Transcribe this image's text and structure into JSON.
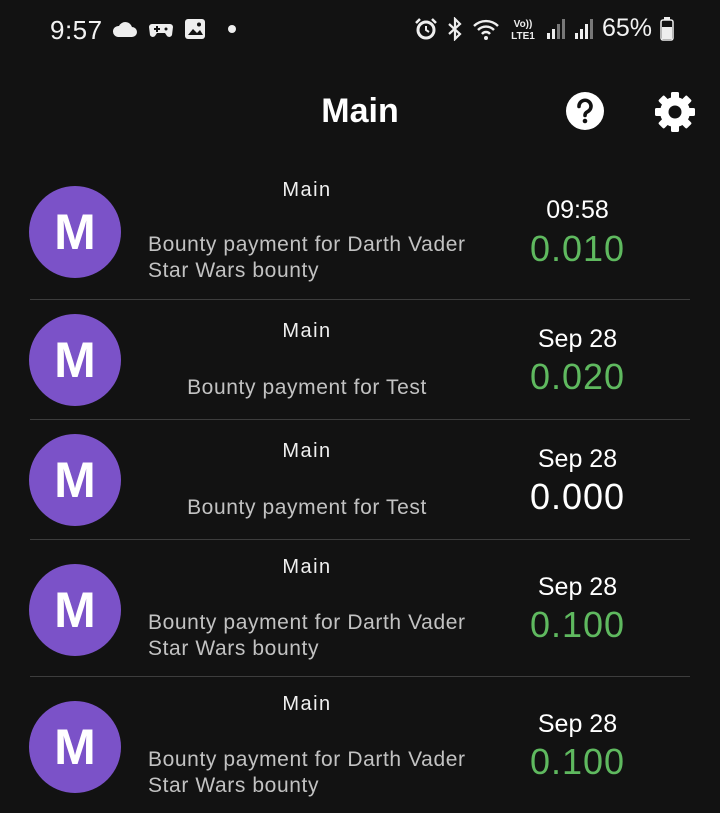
{
  "status_bar": {
    "time": "9:57",
    "battery": "65%",
    "network_label": "Vo)) LTE1",
    "icons": [
      "cloud-icon",
      "controller-icon",
      "image-icon",
      "dot-icon",
      "alarm-icon",
      "bluetooth-icon",
      "wifi-icon",
      "signal-icon",
      "battery-icon"
    ]
  },
  "app_bar": {
    "title": "Main",
    "help_icon": "help-circle-icon",
    "settings_icon": "gear-icon"
  },
  "colors": {
    "background": "#121212",
    "avatar": "#7b52c8",
    "amount_positive": "#5fb95f",
    "divider": "#3d3d3d"
  },
  "transactions": [
    {
      "avatar_letter": "M",
      "account": "Main",
      "memo": "Bounty payment for Darth Vader Star Wars bounty",
      "date": "09:58",
      "amount": "0.010",
      "amount_color": "green"
    },
    {
      "avatar_letter": "M",
      "account": "Main",
      "memo": "Bounty payment for Test",
      "date": "Sep 28",
      "amount": "0.020",
      "amount_color": "green"
    },
    {
      "avatar_letter": "M",
      "account": "Main",
      "memo": "Bounty payment for Test",
      "date": "Sep 28",
      "amount": "0.000",
      "amount_color": "white"
    },
    {
      "avatar_letter": "M",
      "account": "Main",
      "memo": "Bounty payment for Darth Vader Star Wars bounty",
      "date": "Sep 28",
      "amount": "0.100",
      "amount_color": "green"
    },
    {
      "avatar_letter": "M",
      "account": "Main",
      "memo": "Bounty payment for Darth Vader Star Wars bounty",
      "date": "Sep 28",
      "amount": "0.100",
      "amount_color": "green"
    }
  ]
}
